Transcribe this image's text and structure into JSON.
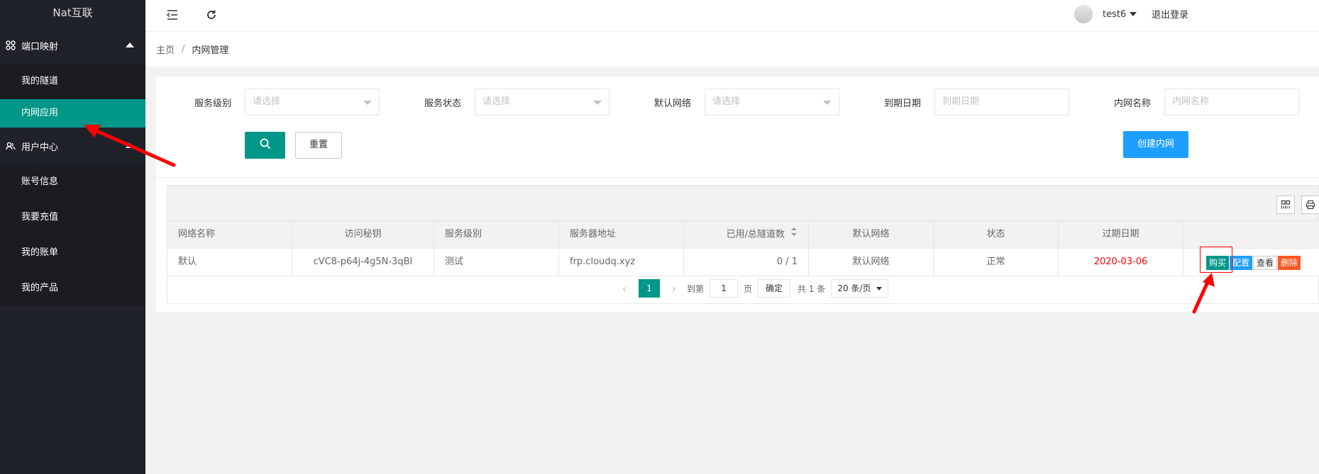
{
  "app": {
    "title": "Nat互联"
  },
  "sidebar": {
    "groups": [
      {
        "label": "端口映射",
        "icon": "cluster-icon",
        "items": [
          {
            "label": "我的隧道"
          },
          {
            "label": "内网应用",
            "active": true
          }
        ]
      },
      {
        "label": "用户中心",
        "icon": "users-icon",
        "items": [
          {
            "label": "账号信息"
          },
          {
            "label": "我要充值"
          },
          {
            "label": "我的账单"
          },
          {
            "label": "我的产品"
          }
        ]
      }
    ]
  },
  "header": {
    "username": "test6",
    "logout": "退出登录"
  },
  "breadcrumb": {
    "home": "主页",
    "separator": "/",
    "current": "内网管理"
  },
  "filters": [
    {
      "label": "服务级别",
      "placeholder": "请选择",
      "type": "select"
    },
    {
      "label": "服务状态",
      "placeholder": "请选择",
      "type": "select"
    },
    {
      "label": "默认网络",
      "placeholder": "请选择",
      "type": "select"
    },
    {
      "label": "到期日期",
      "placeholder": "到期日期",
      "type": "input"
    },
    {
      "label": "内网名称",
      "placeholder": "内网名称",
      "type": "input"
    }
  ],
  "buttons": {
    "reset": "重置",
    "create": "创建内网"
  },
  "table": {
    "columns": [
      "网络名称",
      "访问秘钥",
      "服务级别",
      "服务器地址",
      "已用/总隧道数",
      "默认网络",
      "状态",
      "过期日期",
      ""
    ],
    "rows": [
      {
        "name": "默认",
        "key": "cVC8-p64j-4g5N-3qBI",
        "level": "测试",
        "server": "frp.cloudq.xyz",
        "tunnels": "0 / 1",
        "default_net": "默认网络",
        "status": "正常",
        "expire": "2020-03-06"
      }
    ],
    "actions": {
      "buy": "购买",
      "config": "配置",
      "view": "查看",
      "delete": "删除"
    },
    "expire_color": "#ff0000"
  },
  "pagination": {
    "current": "1",
    "goto_prefix": "到第",
    "goto_value": "1",
    "goto_suffix": "页",
    "confirm": "确定",
    "total": "共 1 条",
    "page_size": "20 条/页"
  },
  "colors": {
    "primary": "#009688",
    "blue": "#1e9fff",
    "danger": "#ff5722",
    "sidebar": "#20222a"
  }
}
